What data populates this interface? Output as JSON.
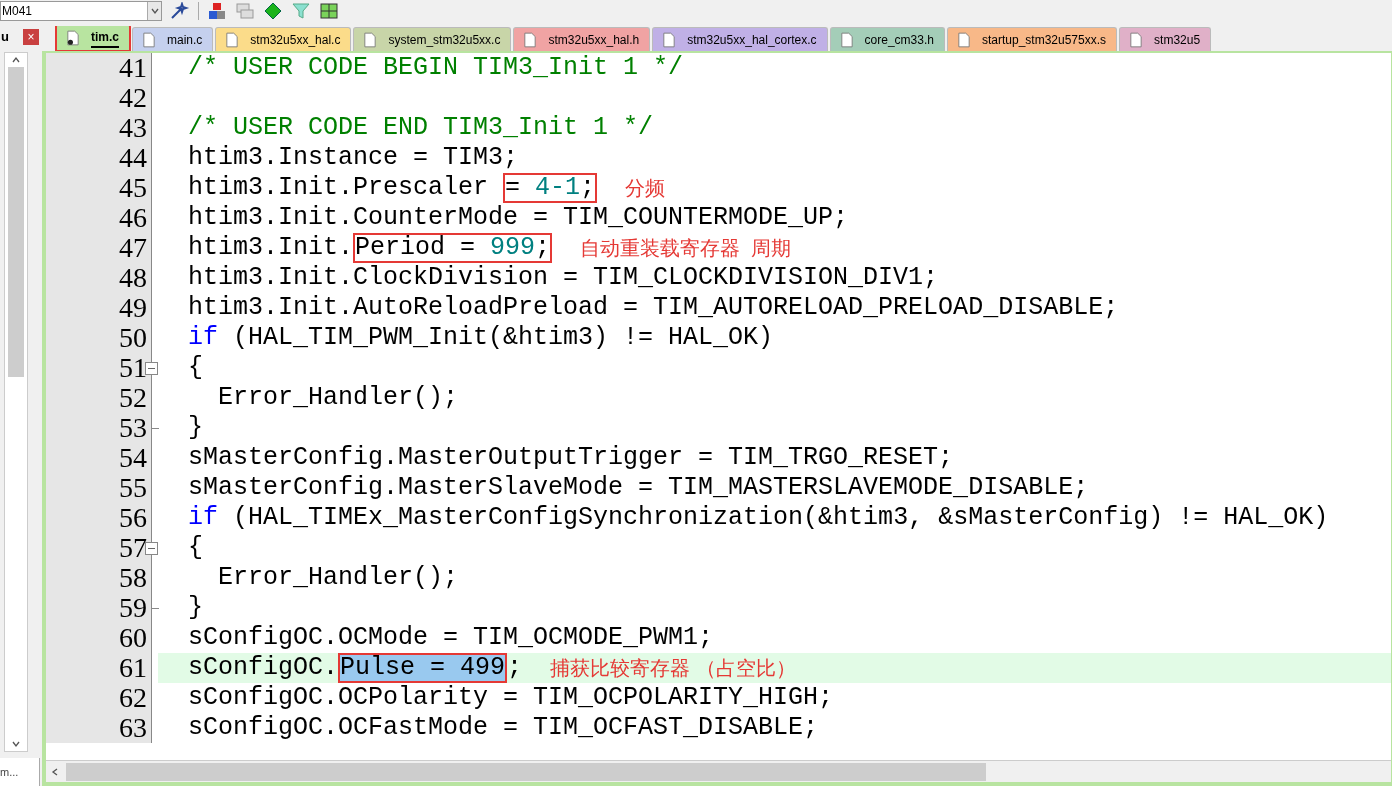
{
  "toolbar": {
    "combo_value": "M041"
  },
  "side_panel": {
    "label": "u",
    "close": "×",
    "bottom_tab": "m..."
  },
  "tabs": [
    {
      "label": "tim.c",
      "selected": true,
      "color": "#b8e4a0",
      "modified": true,
      "boxed": true
    },
    {
      "label": "main.c",
      "selected": false,
      "color": "#c5d0ee",
      "modified": false,
      "boxed": false
    },
    {
      "label": "stm32u5xx_hal.c",
      "selected": false,
      "color": "#fbdc8a",
      "modified": false,
      "boxed": false
    },
    {
      "label": "system_stm32u5xx.c",
      "selected": false,
      "color": "#c8d5a8",
      "modified": false,
      "boxed": false
    },
    {
      "label": "stm32u5xx_hal.h",
      "selected": false,
      "color": "#f0a3a3",
      "modified": false,
      "boxed": false
    },
    {
      "label": "stm32u5xx_hal_cortex.c",
      "selected": false,
      "color": "#c0b0e6",
      "modified": false,
      "boxed": false
    },
    {
      "label": "core_cm33.h",
      "selected": false,
      "color": "#a4cdb8",
      "modified": false,
      "boxed": false
    },
    {
      "label": "startup_stm32u575xx.s",
      "selected": false,
      "color": "#f8b888",
      "modified": false,
      "boxed": false
    },
    {
      "label": "stm32u5",
      "selected": false,
      "color": "#e0b0c8",
      "modified": false,
      "boxed": false
    }
  ],
  "lines": [
    {
      "number": "41",
      "current": false,
      "segments": [
        {
          "text": "/* USER CODE BEGIN TIM3_Init 1 */",
          "kind": "comment",
          "boxed": false
        }
      ]
    },
    {
      "number": "42",
      "current": false
    },
    {
      "number": "43",
      "current": false,
      "segments": [
        {
          "text": "/* USER CODE END TIM3_Init 1 */",
          "kind": "comment",
          "boxed": false
        }
      ]
    },
    {
      "number": "44",
      "current": false,
      "segments": [
        {
          "text": "htim3.Instance = TIM3;",
          "kind": "plain",
          "boxed": false
        }
      ]
    },
    {
      "number": "45",
      "current": false,
      "note": "分频",
      "segments": [
        {
          "text": "htim3.Init.Prescaler ",
          "kind": "plain",
          "boxed": false
        },
        {
          "text": "= ",
          "kind": "plain",
          "boxed": true
        },
        {
          "text": "4-1",
          "kind": "number",
          "boxed": true
        },
        {
          "text": ";",
          "kind": "plain",
          "boxed": true
        }
      ]
    },
    {
      "number": "46",
      "current": false,
      "segments": [
        {
          "text": "htim3.Init.CounterMode = TIM_COUNTERMODE_UP;",
          "kind": "plain",
          "boxed": false
        }
      ]
    },
    {
      "number": "47",
      "current": false,
      "note": "自动重装载寄存器  周期",
      "segments": [
        {
          "text": "htim3.Init.",
          "kind": "plain",
          "boxed": false
        },
        {
          "text": "Period = ",
          "kind": "plain",
          "boxed": true
        },
        {
          "text": "999",
          "kind": "number",
          "boxed": true
        },
        {
          "text": ";",
          "kind": "plain",
          "boxed": true
        }
      ]
    },
    {
      "number": "48",
      "current": false,
      "segments": [
        {
          "text": "htim3.Init.ClockDivision = TIM_CLOCKDIVISION_DIV1;",
          "kind": "plain",
          "boxed": false
        }
      ]
    },
    {
      "number": "49",
      "current": false,
      "segments": [
        {
          "text": "htim3.Init.AutoReloadPreload = TIM_AUTORELOAD_PRELOAD_DISABLE;",
          "kind": "plain",
          "boxed": false
        }
      ]
    },
    {
      "number": "50",
      "current": false,
      "segments": [
        {
          "text": "if",
          "kind": "keyword",
          "boxed": false
        },
        {
          "text": " (HAL_TIM_PWM_Init(&htim3) != HAL_OK)",
          "kind": "plain",
          "boxed": false
        }
      ]
    },
    {
      "number": "51",
      "fold_start": true,
      "current": false,
      "segments": [
        {
          "text": "{",
          "kind": "plain",
          "boxed": false
        }
      ]
    },
    {
      "number": "52",
      "current": false,
      "segments": [
        {
          "text": "  Error_Handler();",
          "kind": "plain",
          "boxed": false
        }
      ]
    },
    {
      "number": "53",
      "fold_end": true,
      "current": false,
      "segments": [
        {
          "text": "}",
          "kind": "plain",
          "boxed": false
        }
      ]
    },
    {
      "number": "54",
      "current": false,
      "segments": [
        {
          "text": "sMasterConfig.MasterOutputTrigger = TIM_TRGO_RESET;",
          "kind": "plain",
          "boxed": false
        }
      ]
    },
    {
      "number": "55",
      "current": false,
      "segments": [
        {
          "text": "sMasterConfig.MasterSlaveMode = TIM_MASTERSLAVEMODE_DISABLE;",
          "kind": "plain",
          "boxed": false
        }
      ]
    },
    {
      "number": "56",
      "current": false,
      "segments": [
        {
          "text": "if",
          "kind": "keyword",
          "boxed": false
        },
        {
          "text": " (HAL_TIMEx_MasterConfigSynchronization(&htim3, &sMasterConfig) != HAL_OK)",
          "kind": "plain",
          "boxed": false
        }
      ]
    },
    {
      "number": "57",
      "fold_start": true,
      "current": false,
      "segments": [
        {
          "text": "{",
          "kind": "plain",
          "boxed": false
        }
      ]
    },
    {
      "number": "58",
      "current": false,
      "segments": [
        {
          "text": "  Error_Handler();",
          "kind": "plain",
          "boxed": false
        }
      ]
    },
    {
      "number": "59",
      "fold_end": true,
      "current": false,
      "segments": [
        {
          "text": "}",
          "kind": "plain",
          "boxed": false
        }
      ]
    },
    {
      "number": "60",
      "current": false,
      "segments": [
        {
          "text": "sConfigOC.OCMode = TIM_OCMODE_PWM1;",
          "kind": "plain",
          "boxed": false
        }
      ]
    },
    {
      "number": "61",
      "current": true,
      "note": "捕获比较寄存器 （占空比）",
      "segments": [
        {
          "text": "sConfigOC.",
          "kind": "plain",
          "boxed": false
        },
        {
          "text": "Pulse = 499",
          "kind": "selected",
          "boxed": true
        },
        {
          "text": ";",
          "kind": "plain",
          "boxed": false
        }
      ]
    },
    {
      "number": "62",
      "current": false,
      "segments": [
        {
          "text": "sConfigOC.OCPolarity = TIM_OCPOLARITY_HIGH;",
          "kind": "plain",
          "boxed": false
        }
      ]
    },
    {
      "number": "63",
      "current": false,
      "segments": [
        {
          "text": "sConfigOC.OCFastMode = TIM_OCFAST_DISABLE;",
          "kind": "plain",
          "boxed": false
        }
      ]
    }
  ]
}
